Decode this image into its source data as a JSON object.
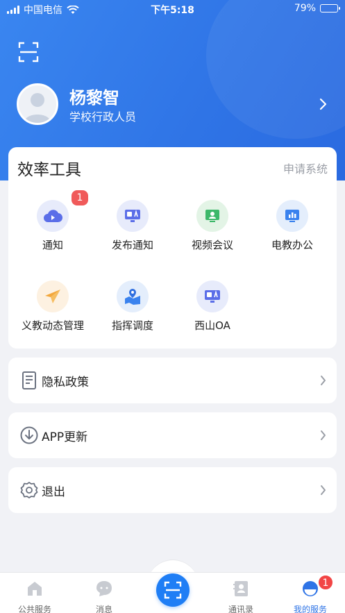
{
  "status_bar": {
    "carrier": "中国电信",
    "time": "下午5:18",
    "battery": "79%",
    "battery_level": 0.79
  },
  "profile": {
    "name": "杨黎智",
    "role": "学校行政人员"
  },
  "tools": {
    "title": "效率工具",
    "link": "申请系统",
    "items": [
      {
        "label": "通知",
        "icon": "cloud-play-icon",
        "badge": "1"
      },
      {
        "label": "发布通知",
        "icon": "oa-monitor-icon"
      },
      {
        "label": "视频会议",
        "icon": "video-meeting-icon"
      },
      {
        "label": "电教办公",
        "icon": "chart-board-icon"
      },
      {
        "label": "义教动态管理",
        "icon": "paper-plane-icon"
      },
      {
        "label": "指挥调度",
        "icon": "map-pin-icon"
      },
      {
        "label": "西山OA",
        "icon": "oa-monitor-icon"
      }
    ]
  },
  "menu": {
    "privacy": "隐私政策",
    "update": "APP更新",
    "logout": "退出"
  },
  "tabbar": {
    "items": [
      {
        "label": "公共服务",
        "icon": "home-icon"
      },
      {
        "label": "消息",
        "icon": "chat-bubble-icon"
      },
      {
        "label": "通讯录",
        "icon": "contacts-icon"
      },
      {
        "label": "我的服务",
        "icon": "my-service-icon"
      }
    ],
    "center_icon": "scan-icon",
    "badge": "1"
  },
  "colors": {
    "primary": "#2f74e6",
    "badge": "#f05a5a",
    "background": "#f1f2f6"
  }
}
